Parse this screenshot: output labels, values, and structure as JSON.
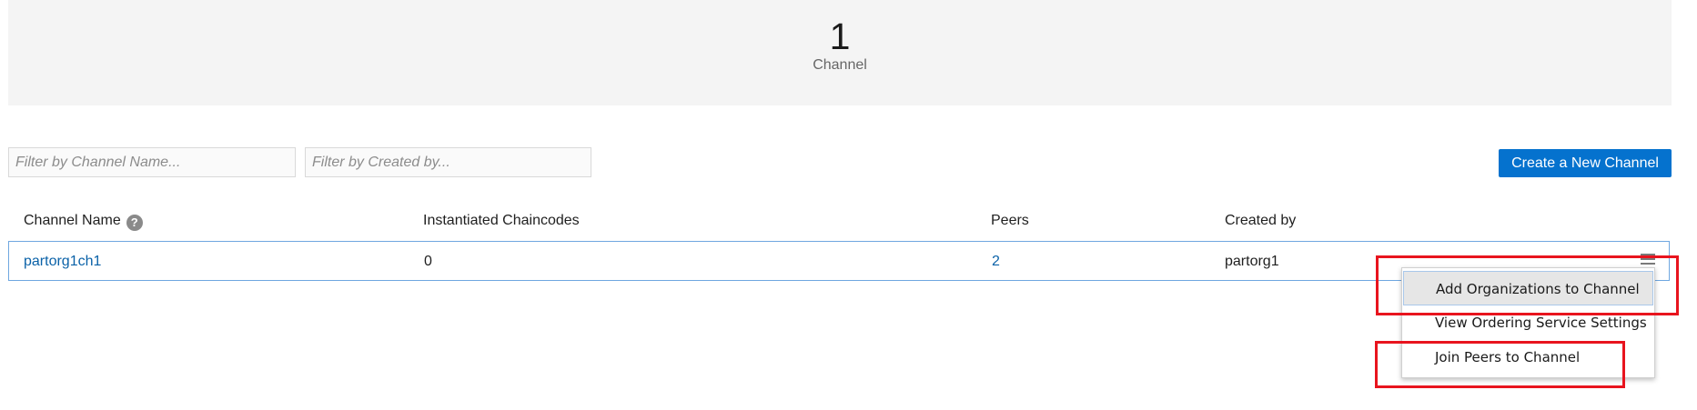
{
  "summary": {
    "count": "1",
    "label": "Channel"
  },
  "filters": {
    "channel_name_placeholder": "Filter by Channel Name...",
    "created_by_placeholder": "Filter by Created by..."
  },
  "toolbar": {
    "create_label": "Create a New Channel"
  },
  "table": {
    "headers": {
      "channel_name": "Channel Name",
      "instantiated_chaincodes": "Instantiated Chaincodes",
      "peers": "Peers",
      "created_by": "Created by"
    },
    "help_icon_glyph": "?",
    "rows": [
      {
        "channel_name": "partorg1ch1",
        "instantiated_chaincodes": "0",
        "peers": "2",
        "created_by": "partorg1"
      }
    ]
  },
  "row_menu": {
    "icon": "hamburger-menu-icon",
    "items": [
      {
        "label": "Add Organizations to Channel",
        "highlighted": true
      },
      {
        "label": "View Ordering Service Settings",
        "highlighted": false
      },
      {
        "label": "Join Peers to Channel",
        "highlighted": false
      }
    ]
  },
  "annotations": {
    "color": "#e8141e",
    "boxes": [
      "Add Organizations to Channel",
      "Join Peers to Channel"
    ]
  },
  "colors": {
    "primary_button": "#0572ce",
    "link": "#0b62a8",
    "row_border": "#6fa7e0",
    "summary_bg": "#f4f4f4"
  }
}
